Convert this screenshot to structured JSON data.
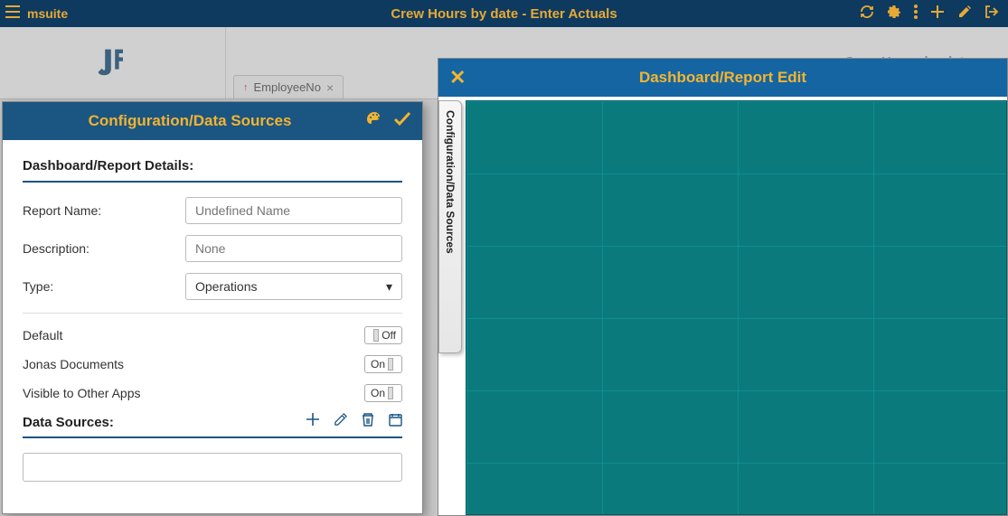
{
  "topbar": {
    "brand": "msuite",
    "title": "Crew Hours by date - Enter Actuals"
  },
  "substrip": {
    "tab_label": "EmployeeNo",
    "sub_title": "Crew Hours by date"
  },
  "edit_panel": {
    "title": "Dashboard/Report Edit",
    "side_tab_label": "Configuration/Data Sources"
  },
  "config": {
    "title": "Configuration/Data Sources",
    "section_details": "Dashboard/Report Details:",
    "labels": {
      "report_name": "Report Name:",
      "description": "Description:",
      "type": "Type:",
      "default": "Default",
      "jonas_docs": "Jonas Documents",
      "visible_other": "Visible to Other Apps",
      "data_sources": "Data Sources:"
    },
    "placeholders": {
      "report_name": "Undefined Name",
      "description": "None"
    },
    "values": {
      "type": "Operations",
      "default": "Off",
      "jonas_docs": "On",
      "visible_other": "On"
    }
  }
}
